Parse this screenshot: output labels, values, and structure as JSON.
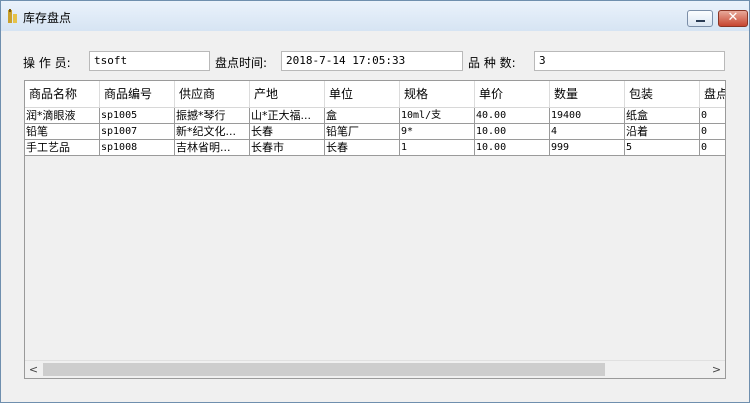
{
  "window": {
    "title": "库存盘点",
    "minimize_icon": "minimize-icon",
    "close_icon": "close-icon"
  },
  "form": {
    "operator_label": "操 作 员:",
    "operator_value": "tsoft",
    "time_label": "盘点时间:",
    "time_value": "2018-7-14 17:05:33",
    "count_label": "品 种 数:",
    "count_value": "3"
  },
  "table": {
    "columns": [
      "商品名称",
      "商品编号",
      "供应商",
      "产地",
      "单位",
      "规格",
      "单价",
      "数量",
      "包装",
      "盘点"
    ],
    "rows": [
      [
        "润*滴眼液",
        "sp1005",
        "振撼*琴行",
        "山*正大福...",
        "盒",
        "10ml/支",
        "40.00",
        "19400",
        "纸盒",
        "0"
      ],
      [
        "铅笔",
        "sp1007",
        "新*纪文化...",
        "长春",
        "铅笔厂",
        "9*",
        "10.00",
        "4",
        "沿着",
        "0"
      ],
      [
        "手工艺品",
        "sp1008",
        "吉林省明...",
        "长春市",
        "长春",
        "1",
        "10.00",
        "999",
        "5",
        "0"
      ]
    ]
  },
  "scrollbar": {
    "left_arrow": "<",
    "right_arrow": ">"
  },
  "colors": {
    "accent_close": "#c7452f",
    "grid_border": "#9a9a9a"
  }
}
